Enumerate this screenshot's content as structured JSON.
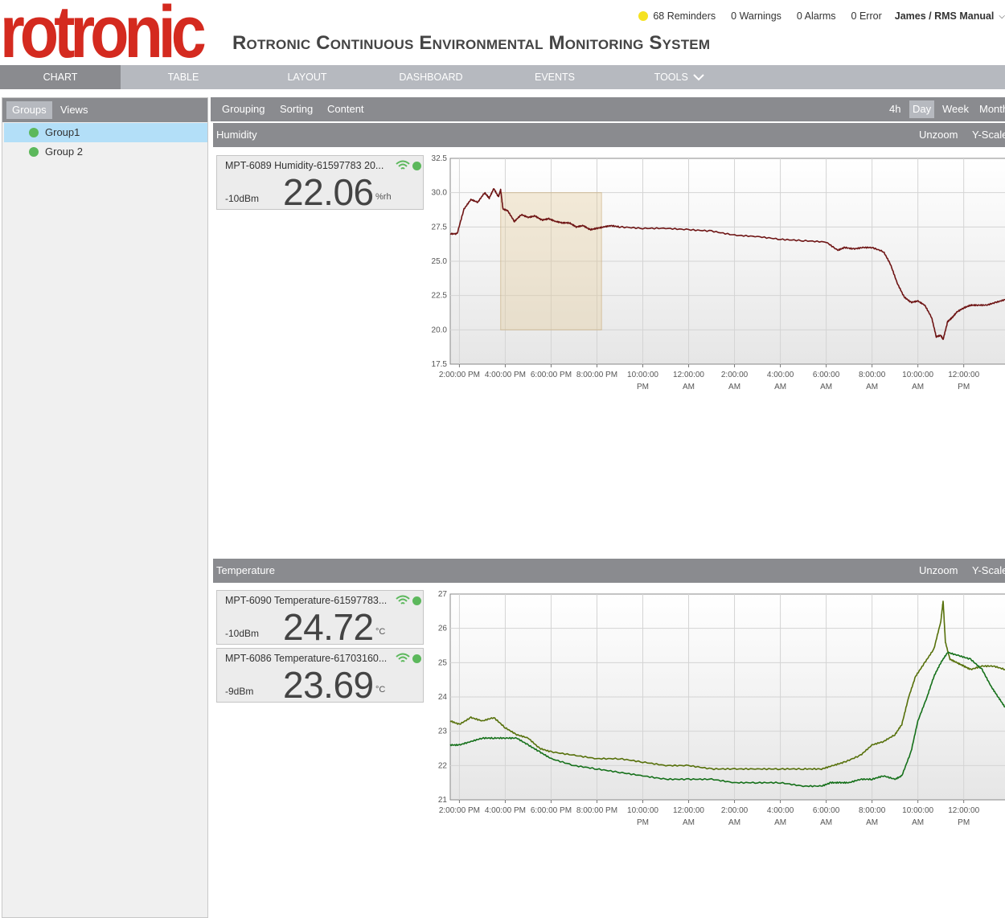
{
  "header": {
    "logo_text": "rotronic",
    "app_title": "Rotronic Continuous Environmental Monitoring System",
    "reminders": "68 Reminders",
    "warnings": "0 Warnings",
    "alarms": "0 Alarms",
    "errors": "0 Error",
    "user": "James / RMS Manual",
    "reminder_color": "#f5e221"
  },
  "nav": {
    "items": [
      "CHART",
      "TABLE",
      "LAYOUT",
      "DASHBOARD",
      "EVENTS",
      "TOOLS"
    ],
    "active": "CHART"
  },
  "sidebar": {
    "tabs": [
      "Groups",
      "Views"
    ],
    "groups": [
      "Group1",
      "Group 2"
    ]
  },
  "toolbar": {
    "grouping": "Grouping",
    "sorting": "Sorting",
    "content": "Content",
    "ranges": [
      "4h",
      "Day",
      "Week",
      "Month"
    ],
    "active_range": "Day"
  },
  "panels": [
    {
      "title": "Humidity",
      "unzoom": "Unzoom",
      "yscale": "Y-Scale",
      "sensors": [
        {
          "name": "MPT-6089 Humidity-61597783 20...",
          "signal": "-10dBm",
          "value": "22.06",
          "unit": "%rh"
        }
      ]
    },
    {
      "title": "Temperature",
      "unzoom": "Unzoom",
      "yscale": "Y-Scale",
      "sensors": [
        {
          "name": "MPT-6090 Temperature-61597783...",
          "signal": "-10dBm",
          "value": "24.72",
          "unit": "°C"
        },
        {
          "name": "MPT-6086 Temperature-61703160...",
          "signal": "-9dBm",
          "value": "23.69",
          "unit": "°C"
        }
      ]
    }
  ],
  "chart_data": [
    {
      "type": "line",
      "x_ticks": [
        [
          "2:00:00 PM"
        ],
        [
          "4:00:00 PM"
        ],
        [
          "6:00:00 PM"
        ],
        [
          "8:00:00 PM"
        ],
        [
          "10:00:00",
          "PM"
        ],
        [
          "12:00:00",
          "AM"
        ],
        [
          "2:00:00",
          "AM"
        ],
        [
          "4:00:00",
          "AM"
        ],
        [
          "6:00:00",
          "AM"
        ],
        [
          "8:00:00",
          "AM"
        ],
        [
          "10:00:00",
          "AM"
        ],
        [
          "12:00:00",
          "PM"
        ]
      ],
      "x_hours": [
        0,
        2,
        4,
        6,
        8,
        10,
        12,
        14,
        16,
        18,
        20,
        22
      ],
      "xlim_hours": [
        -0.4,
        23.8
      ],
      "ylim": [
        17.5,
        32.5
      ],
      "y_ticks": [
        "17.5",
        "20.0",
        "22.5",
        "25.0",
        "27.5",
        "30.0",
        "32.5"
      ],
      "grid": true,
      "zoom_selection_hours": [
        1.8,
        6.2
      ],
      "zoom_selection_y": [
        20.0,
        30.0
      ],
      "series": [
        {
          "color": "#6e1414",
          "hours": [
            -0.4,
            -0.1,
            0.2,
            0.5,
            0.8,
            1.1,
            1.3,
            1.5,
            1.7,
            1.8,
            1.9,
            2.1,
            2.4,
            2.7,
            3.0,
            3.3,
            3.6,
            3.9,
            4.2,
            4.5,
            4.8,
            5.1,
            5.4,
            5.7,
            6.0,
            6.3,
            6.6,
            7.0,
            8.0,
            9.0,
            10.0,
            11.0,
            12.0,
            13.0,
            14.0,
            15.0,
            16.0,
            16.5,
            16.8,
            17.2,
            17.6,
            18.0,
            18.5,
            18.8,
            19.1,
            19.4,
            19.7,
            20.0,
            20.3,
            20.6,
            20.8,
            21.0,
            21.1,
            21.3,
            21.5,
            21.7,
            22.0,
            22.3,
            22.6,
            23.0,
            23.4,
            23.8
          ],
          "values": [
            27.0,
            27.0,
            28.8,
            29.5,
            29.3,
            30.0,
            29.6,
            30.3,
            29.7,
            30.2,
            28.8,
            28.7,
            27.9,
            28.4,
            28.2,
            28.3,
            28.0,
            28.1,
            27.9,
            27.8,
            27.8,
            27.5,
            27.6,
            27.3,
            27.4,
            27.5,
            27.6,
            27.5,
            27.4,
            27.4,
            27.3,
            27.2,
            26.9,
            26.8,
            26.6,
            26.5,
            26.4,
            25.8,
            26.0,
            25.9,
            26.0,
            26.0,
            25.7,
            24.8,
            23.4,
            22.4,
            22.0,
            22.1,
            21.8,
            20.9,
            19.5,
            19.6,
            19.3,
            20.6,
            20.9,
            21.3,
            21.6,
            21.8,
            21.8,
            21.8,
            22.0,
            22.2
          ]
        }
      ]
    },
    {
      "type": "line",
      "x_ticks": [
        [
          "2:00:00 PM"
        ],
        [
          "4:00:00 PM"
        ],
        [
          "6:00:00 PM"
        ],
        [
          "8:00:00 PM"
        ],
        [
          "10:00:00",
          "PM"
        ],
        [
          "12:00:00",
          "AM"
        ],
        [
          "2:00:00",
          "AM"
        ],
        [
          "4:00:00",
          "AM"
        ],
        [
          "6:00:00",
          "AM"
        ],
        [
          "8:00:00",
          "AM"
        ],
        [
          "10:00:00",
          "AM"
        ],
        [
          "12:00:00",
          "PM"
        ]
      ],
      "x_hours": [
        0,
        2,
        4,
        6,
        8,
        10,
        12,
        14,
        16,
        18,
        20,
        22
      ],
      "xlim_hours": [
        -0.4,
        23.8
      ],
      "ylim": [
        21,
        27
      ],
      "y_ticks": [
        "21",
        "22",
        "23",
        "24",
        "25",
        "26",
        "27"
      ],
      "grid": true,
      "series": [
        {
          "color": "#56700a",
          "hours": [
            -0.4,
            0.0,
            0.5,
            1.0,
            1.5,
            2.0,
            2.5,
            3.0,
            3.5,
            4.0,
            5.0,
            6.0,
            7.0,
            8.0,
            9.0,
            10.0,
            11.0,
            12.0,
            13.0,
            14.0,
            15.0,
            15.8,
            16.3,
            16.8,
            17.5,
            18.0,
            18.5,
            19.0,
            19.3,
            19.6,
            19.9,
            20.3,
            20.7,
            21.0,
            21.1,
            21.2,
            21.4,
            21.7,
            22.0,
            22.3,
            22.8,
            23.3,
            23.8
          ],
          "values": [
            23.3,
            23.2,
            23.4,
            23.3,
            23.4,
            23.1,
            22.9,
            22.8,
            22.5,
            22.4,
            22.3,
            22.2,
            22.2,
            22.1,
            22.0,
            22.0,
            21.9,
            21.9,
            21.9,
            21.9,
            21.9,
            21.9,
            22.0,
            22.1,
            22.3,
            22.6,
            22.7,
            22.9,
            23.2,
            24.0,
            24.6,
            25.0,
            25.4,
            26.2,
            26.8,
            25.6,
            25.1,
            25.0,
            24.9,
            24.8,
            24.9,
            24.9,
            24.8
          ]
        },
        {
          "color": "#15701a",
          "hours": [
            -0.4,
            0.0,
            0.5,
            1.0,
            1.5,
            2.0,
            2.5,
            3.0,
            3.5,
            4.0,
            5.0,
            6.0,
            7.0,
            8.0,
            9.0,
            10.0,
            11.0,
            12.0,
            13.0,
            14.0,
            15.0,
            15.8,
            16.2,
            16.6,
            17.0,
            17.5,
            18.0,
            18.5,
            19.0,
            19.3,
            19.7,
            20.0,
            20.4,
            20.7,
            21.0,
            21.3,
            21.8,
            22.3,
            22.8,
            23.2,
            23.5,
            23.8
          ],
          "values": [
            22.6,
            22.6,
            22.7,
            22.8,
            22.8,
            22.8,
            22.8,
            22.6,
            22.4,
            22.2,
            22.0,
            21.9,
            21.8,
            21.7,
            21.6,
            21.6,
            21.6,
            21.5,
            21.5,
            21.5,
            21.4,
            21.4,
            21.5,
            21.5,
            21.5,
            21.6,
            21.6,
            21.7,
            21.6,
            21.7,
            22.4,
            23.3,
            24.0,
            24.6,
            25.0,
            25.3,
            25.2,
            25.1,
            24.8,
            24.3,
            24.0,
            23.7
          ]
        }
      ]
    }
  ]
}
